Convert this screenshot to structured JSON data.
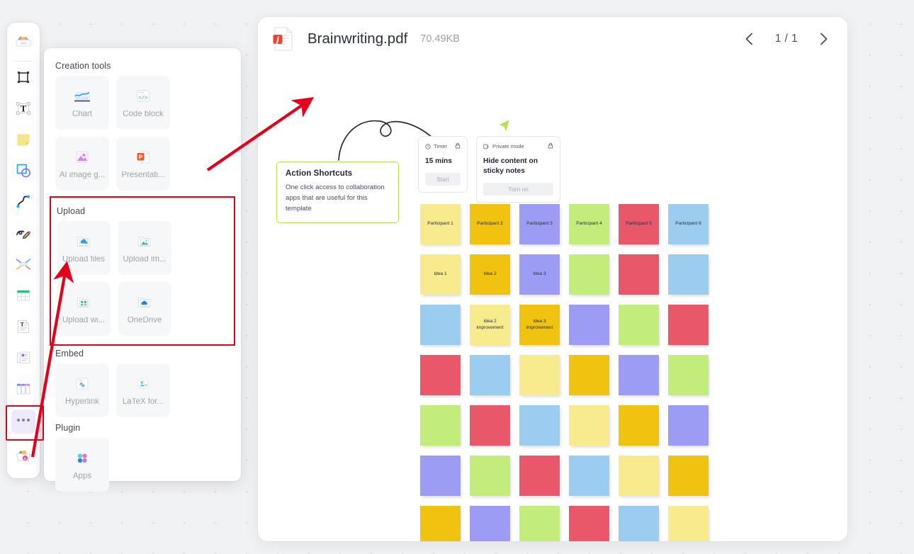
{
  "toolbar": {
    "items": [
      {
        "name": "templates",
        "icon": "templates-icon"
      },
      {
        "name": "frame",
        "icon": "frame-icon"
      },
      {
        "name": "text",
        "icon": "text-icon"
      },
      {
        "name": "sticky-note",
        "icon": "sticky-note-icon"
      },
      {
        "name": "shapes",
        "icon": "shapes-icon"
      },
      {
        "name": "connector",
        "icon": "connector-icon"
      },
      {
        "name": "pen",
        "icon": "pen-icon"
      },
      {
        "name": "mind-map",
        "icon": "mind-map-icon"
      },
      {
        "name": "table",
        "icon": "table-icon"
      },
      {
        "name": "document",
        "icon": "document-icon"
      },
      {
        "name": "card",
        "icon": "card-icon"
      },
      {
        "name": "kanban",
        "icon": "kanban-icon"
      },
      {
        "name": "more-tools",
        "icon": "more-tools-icon",
        "selected": true,
        "annotated": true
      },
      {
        "name": "toolbox",
        "icon": "toolbox-icon"
      }
    ]
  },
  "panel": {
    "groups": [
      {
        "key": "creation",
        "title": "Creation tools",
        "tiles": [
          {
            "label": "Chart",
            "icon": "chart-icon"
          },
          {
            "label": "Code block",
            "icon": "code-block-icon"
          },
          {
            "label": "AI image g...",
            "icon": "ai-image-icon"
          },
          {
            "label": "Presentati...",
            "icon": "presentation-icon"
          }
        ]
      },
      {
        "key": "upload",
        "title": "Upload",
        "highlighted": true,
        "tiles": [
          {
            "label": "Upload files",
            "icon": "upload-files-icon"
          },
          {
            "label": "Upload im...",
            "icon": "upload-image-icon"
          },
          {
            "label": "Upload wi...",
            "icon": "upload-widget-icon"
          },
          {
            "label": "OneDrive",
            "icon": "onedrive-icon"
          }
        ]
      },
      {
        "key": "embed",
        "title": "Embed",
        "tiles": [
          {
            "label": "Hyperlink",
            "icon": "hyperlink-icon"
          },
          {
            "label": "LaTeX for...",
            "icon": "latex-icon"
          }
        ]
      },
      {
        "key": "plugin",
        "title": "Plugin",
        "tiles": [
          {
            "label": "Apps",
            "icon": "apps-icon"
          }
        ]
      }
    ]
  },
  "viewer": {
    "file_icon": "pdf-file-icon",
    "title": "Brainwriting.pdf",
    "size": "70.49KB",
    "prev_icon": "chevron-left-icon",
    "next_icon": "chevron-right-icon",
    "page_indicator": "1 / 1"
  },
  "document": {
    "callout": {
      "heading": "Action Shortcuts",
      "body": "One click access to collaboration apps that are useful for this template",
      "border_color": "#b7e254"
    },
    "cards": [
      {
        "key": "timer",
        "header": "Timer",
        "header_icon": "clock-icon",
        "lock_icon": "lock-icon",
        "body": "15 mins",
        "button": "Start"
      },
      {
        "key": "private-mode",
        "header": "Private mode",
        "header_icon": "private-mode-icon",
        "lock_icon": "lock-icon",
        "body": "Hide content on sticky notes",
        "button": "Turn on"
      }
    ],
    "palette": {
      "lightyellow": "#f7eb8e",
      "gold": "#efc30f",
      "periwinkle": "#9c9cf4",
      "green": "#c2ed7b",
      "red": "#e9576b",
      "blue": "#9bcdf0"
    },
    "sticky_grid": {
      "rows": 7,
      "cols": 6,
      "notes": [
        [
          {
            "c": "lightyellow",
            "t": "Participant 1"
          },
          {
            "c": "gold",
            "t": "Participant 2"
          },
          {
            "c": "periwinkle",
            "t": "Participant 3"
          },
          {
            "c": "green",
            "t": "Participant 4"
          },
          {
            "c": "red",
            "t": "Participant 5"
          },
          {
            "c": "blue",
            "t": "Participant 6"
          }
        ],
        [
          {
            "c": "lightyellow",
            "t": "Idea 1"
          },
          {
            "c": "gold",
            "t": "Idea 2"
          },
          {
            "c": "periwinkle",
            "t": "Idea 3"
          },
          {
            "c": "green",
            "t": ""
          },
          {
            "c": "red",
            "t": ""
          },
          {
            "c": "blue",
            "t": ""
          }
        ],
        [
          {
            "c": "blue",
            "t": ""
          },
          {
            "c": "lightyellow",
            "t": "Idea 2 improvement"
          },
          {
            "c": "gold",
            "t": "Idea 3 improvement"
          },
          {
            "c": "periwinkle",
            "t": ""
          },
          {
            "c": "green",
            "t": ""
          },
          {
            "c": "red",
            "t": ""
          }
        ],
        [
          {
            "c": "red",
            "t": ""
          },
          {
            "c": "blue",
            "t": ""
          },
          {
            "c": "lightyellow",
            "t": ""
          },
          {
            "c": "gold",
            "t": ""
          },
          {
            "c": "periwinkle",
            "t": ""
          },
          {
            "c": "green",
            "t": ""
          }
        ],
        [
          {
            "c": "green",
            "t": ""
          },
          {
            "c": "red",
            "t": ""
          },
          {
            "c": "blue",
            "t": ""
          },
          {
            "c": "lightyellow",
            "t": ""
          },
          {
            "c": "gold",
            "t": ""
          },
          {
            "c": "periwinkle",
            "t": ""
          }
        ],
        [
          {
            "c": "periwinkle",
            "t": ""
          },
          {
            "c": "green",
            "t": ""
          },
          {
            "c": "red",
            "t": ""
          },
          {
            "c": "blue",
            "t": ""
          },
          {
            "c": "lightyellow",
            "t": ""
          },
          {
            "c": "gold",
            "t": ""
          }
        ],
        [
          {
            "c": "gold",
            "t": ""
          },
          {
            "c": "periwinkle",
            "t": ""
          },
          {
            "c": "green",
            "t": ""
          },
          {
            "c": "red",
            "t": ""
          },
          {
            "c": "blue",
            "t": ""
          },
          {
            "c": "lightyellow",
            "t": ""
          }
        ]
      ]
    }
  },
  "annotations": {
    "color": "#e3001b",
    "arrow_to_callout": "arrow-pointing-to-action-shortcuts",
    "arrow_to_onedrive": "arrow-pointing-to-onedrive",
    "box_upload": "highlight-box-upload-section",
    "box_more_tools": "highlight-box-more-tools"
  }
}
